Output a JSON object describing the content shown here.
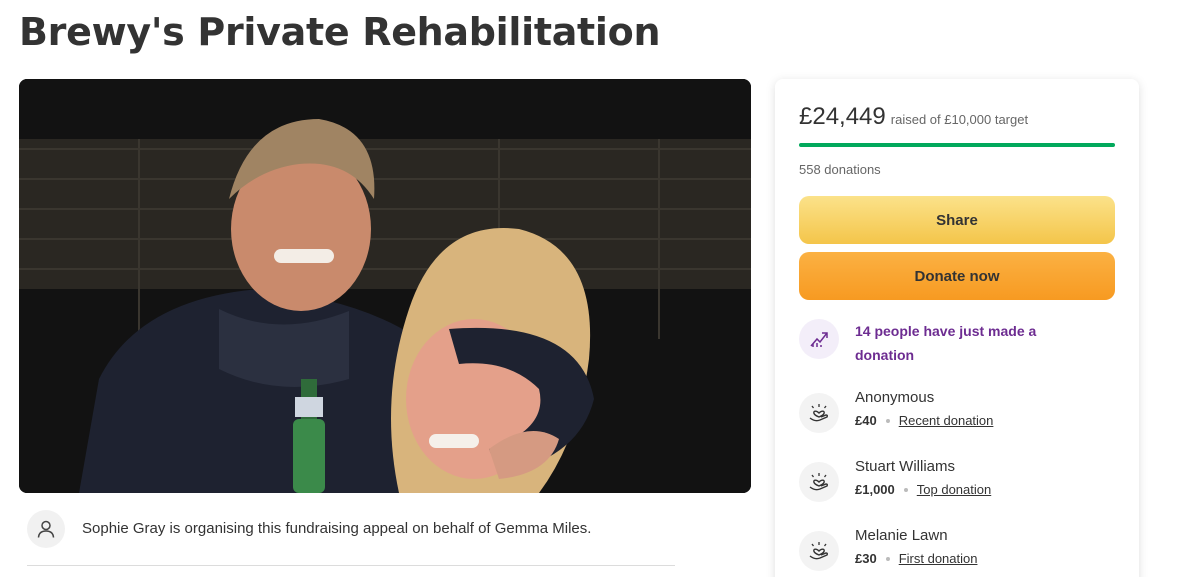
{
  "page": {
    "title": "Brewy's Private Rehabilitation"
  },
  "organiser": {
    "text": "Sophie Gray is organising this fundraising appeal on behalf of Gemma Miles."
  },
  "card": {
    "raised": "£24,449",
    "raised_of": "raised of £10,000 target",
    "progress_fraction": 1.0,
    "donation_count": "558 donations",
    "share_label": "Share",
    "donate_label": "Donate now",
    "trend_text": "14 people have just made a donation",
    "donors": [
      {
        "name": "Anonymous",
        "amount": "£40",
        "tag": "Recent donation"
      },
      {
        "name": "Stuart Williams",
        "amount": "£1,000",
        "tag": "Top donation"
      },
      {
        "name": "Melanie Lawn",
        "amount": "£30",
        "tag": "First donation"
      }
    ]
  },
  "colors": {
    "progress": "#02a95c",
    "share_button": "#f4c54a",
    "donate_button": "#f79a21",
    "trend_text": "#6d2c91"
  },
  "icons": {
    "organiser": "person-icon",
    "trend": "trending-up-icon",
    "donor": "heart-hand-icon"
  }
}
